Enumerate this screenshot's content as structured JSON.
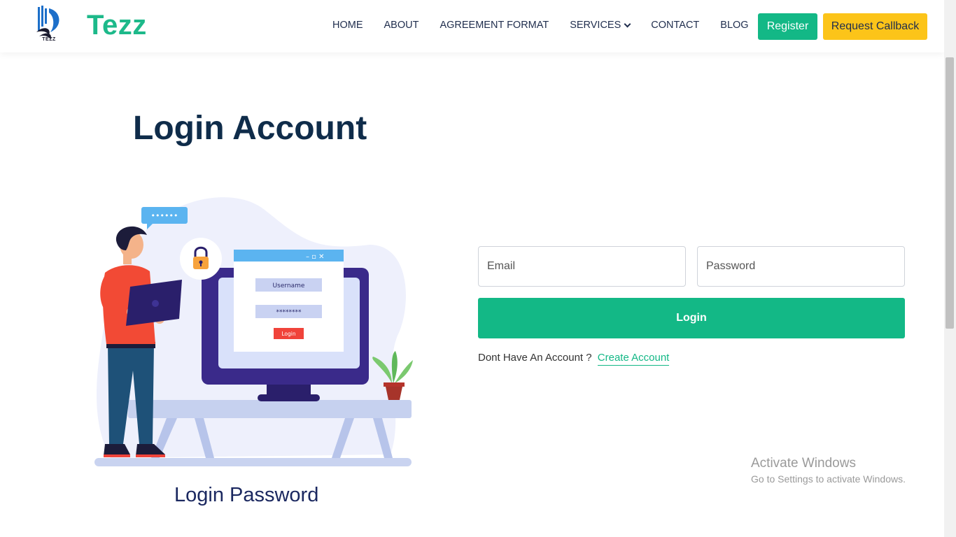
{
  "header": {
    "logo_caption": "TEZZ",
    "brand": "Tezz",
    "nav": [
      {
        "label": "HOME"
      },
      {
        "label": "ABOUT"
      },
      {
        "label": "AGREEMENT FORMAT"
      },
      {
        "label": "SERVICES",
        "has_dropdown": true
      },
      {
        "label": "CONTACT"
      },
      {
        "label": "BLOG"
      }
    ],
    "register_label": "Register",
    "callback_label": "Request Callback"
  },
  "main": {
    "title": "Login Account",
    "illustration": {
      "chat_dots": "••••••",
      "username_label": "Username",
      "password_mask": "********",
      "mini_login_label": "Login",
      "caption": "Login Password"
    }
  },
  "form": {
    "email_placeholder": "Email",
    "password_placeholder": "Password",
    "login_label": "Login",
    "signup_prompt": "Dont Have An Account ?",
    "signup_link": "Create Account"
  },
  "watermark": {
    "title": "Activate Windows",
    "subtitle": "Go to Settings to activate Windows."
  },
  "colors": {
    "brand_green": "#13b886",
    "callback_yellow": "#fcc419",
    "title_navy": "#0f2c4a"
  }
}
